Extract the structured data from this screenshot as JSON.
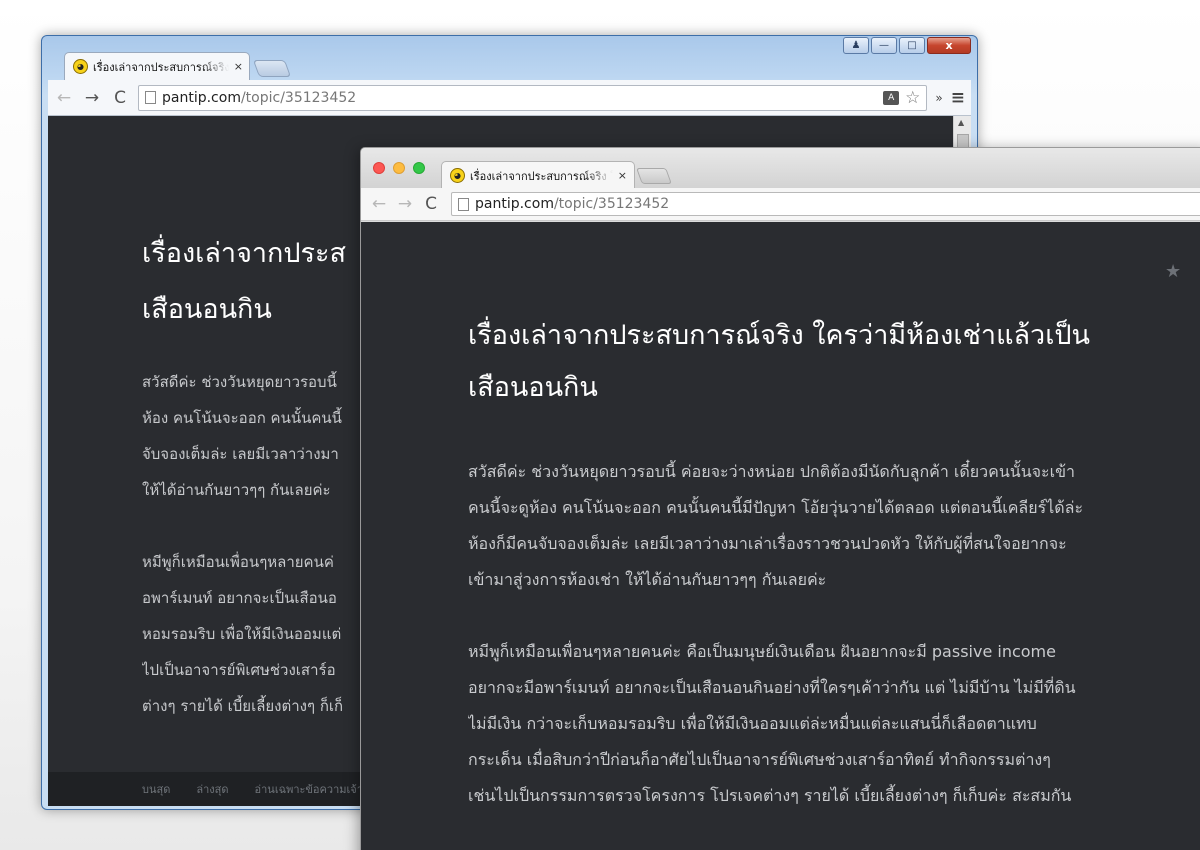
{
  "back_window": {
    "tab": {
      "title": "เรื่องเล่าจากประสบการณ์จริง ใ",
      "close": "×"
    },
    "controls": {
      "user": "♟",
      "minimize": "—",
      "maximize": "□",
      "close": "x"
    },
    "toolbar": {
      "back": "←",
      "forward": "→",
      "reload": "C",
      "url_domain": "pantip.com",
      "url_path": "/topic/35123452",
      "extensions": "»",
      "menu": "≡"
    },
    "page": {
      "title_lines": [
        "เรื่องเล่าจากประส",
        "เสือนอนกิน"
      ],
      "paragraph1": [
        "สวัสดีค่ะ ช่วงวันหยุดยาวรอบนี้",
        "ห้อง คนโน้นจะออก คนนั้นคนนี้",
        "จับจองเต็มล่ะ เลยมีเวลาว่างมา",
        "ให้ได้อ่านกันยาวๆๆ กันเลยค่ะ"
      ],
      "paragraph2": [
        "หมีพูก็เหมือนเพื่อนๆหลายคนค่",
        "อพาร์เมนท์ อยากจะเป็นเสือนอ",
        "หอมรอมริบ เพื่อให้มีเงินออมแต่",
        "ไปเป็นอาจารย์พิเศษช่วงเสาร์อ",
        "ต่างๆ รายได้ เบี้ยเลี้ยงต่างๆ ก็เก็"
      ],
      "footer_links": [
        "บนสุด",
        "ล่างสุด",
        "อ่านเฉพาะข้อความเจ้า"
      ]
    }
  },
  "front_window": {
    "tab": {
      "title": "เรื่องเล่าจากประสบการณ์จริง ใค",
      "close": "×"
    },
    "toolbar": {
      "back": "←",
      "forward": "→",
      "reload": "C",
      "url_domain": "pantip.com",
      "url_path": "/topic/35123452"
    },
    "page": {
      "bookmark": "★",
      "title_lines": [
        "เรื่องเล่าจากประสบการณ์จริง ใครว่ามีห้องเช่าแล้วเป็น",
        "เสือนอนกิน"
      ],
      "paragraph1": [
        "สวัสดีค่ะ ช่วงวันหยุดยาวรอบนี้ ค่อยจะว่างหน่อย ปกติต้องมีนัดกับลูกค้า เดี๋ยวคนนั้นจะเข้า",
        "คนนี้จะดูห้อง คนโน้นจะออก คนนั้นคนนี้มีปัญหา โอ้ยวุ่นวายได้ตลอด แต่ตอนนี้เคลียร์ได้ล่ะ",
        "ห้องก็มีคนจับจองเต็มล่ะ เลยมีเวลาว่างมาเล่าเรื่องราวชวนปวดหัว ให้กับผู้ที่สนใจอยากจะ",
        "เข้ามาสู่วงการห้องเช่า ให้ได้อ่านกันยาวๆๆ กันเลยค่ะ"
      ],
      "paragraph2": [
        "หมีพูก็เหมือนเพื่อนๆหลายคนค่ะ คือเป็นมนุษย์เงินเดือน ฝันอยากจะมี passive income",
        "อยากจะมีอพาร์เมนท์ อยากจะเป็นเสือนอนกินอย่างที่ใครๆเค้าว่ากัน แต่ ไม่มีบ้าน ไม่มีที่ดิน",
        "ไม่มีเงิน กว่าจะเก็บหอมรอมริบ เพื่อให้มีเงินออมแต่ล่ะหมื่นแต่ละแสนนี่ก็เลือดตาแทบ",
        "กระเด็น เมื่อสิบกว่าปีก่อนก็อาศัยไปเป็นอาจารย์พิเศษช่วงเสาร์อาทิตย์ ทำกิจกรรมต่างๆ",
        "เช่นไปเป็นกรรมการตรวจโครงการ โปรเจคต่างๆ รายได้ เบี้ยเลี้ยงต่างๆ ก็เก็บค่ะ สะสมกัน"
      ]
    }
  },
  "colors": {
    "page_bg": "#2a2c30",
    "title_text": "#ffffff",
    "body_text": "#c9cbce"
  }
}
